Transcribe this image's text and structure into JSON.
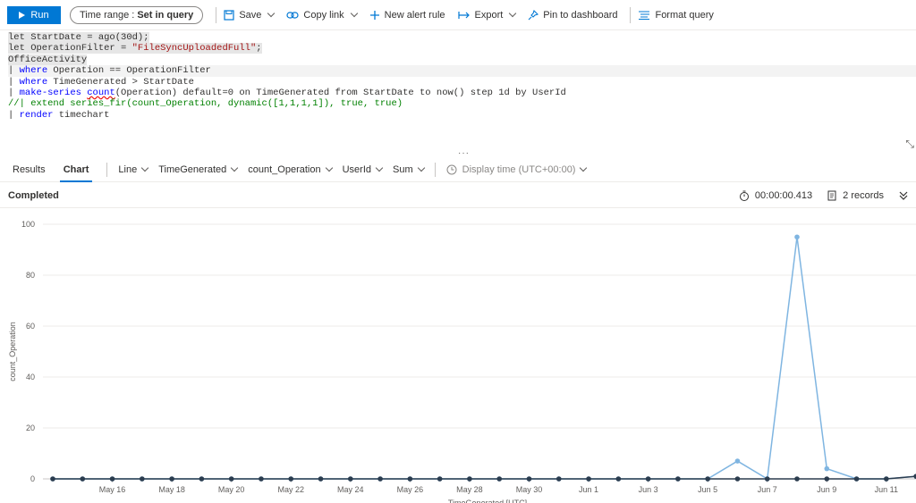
{
  "toolbar": {
    "run_label": "Run",
    "time_range_prefix": "Time range :",
    "time_range_value": "Set in query",
    "save_label": "Save",
    "copy_link_label": "Copy link",
    "new_alert_label": "New alert rule",
    "export_label": "Export",
    "pin_label": "Pin to dashboard",
    "format_label": "Format query"
  },
  "editor": {
    "lines": [
      "let StartDate = ago(30d);",
      "let OperationFilter = \"FileSyncUploadedFull\";",
      "OfficeActivity",
      "| where Operation == OperationFilter",
      "| where TimeGenerated > StartDate",
      "| make-series count(Operation) default=0 on TimeGenerated from StartDate to now() step 1d by UserId",
      "//| extend series_fir(count_Operation, dynamic([1,1,1,1]), true, true)",
      "| render timechart"
    ]
  },
  "tabs": {
    "results_label": "Results",
    "chart_label": "Chart",
    "chart_type": "Line",
    "x_column": "TimeGenerated",
    "y_column": "count_Operation",
    "split_column": "UserId",
    "aggregation": "Sum",
    "display_time": "Display time (UTC+00:00)"
  },
  "status": {
    "state": "Completed",
    "duration": "00:00:00.413",
    "records": "2 records"
  },
  "chart_data": {
    "type": "line",
    "ylabel": "count_Operation",
    "xlabel": "TimeGenerated [UTC]",
    "ylim": [
      0,
      100
    ],
    "y_ticks": [
      "0",
      "20",
      "40",
      "60",
      "80",
      "100"
    ],
    "x_ticks": [
      "May 16",
      "May 18",
      "May 20",
      "May 22",
      "May 24",
      "May 26",
      "May 28",
      "May 30",
      "Jun 1",
      "Jun 3",
      "Jun 5",
      "Jun 7",
      "Jun 9",
      "Jun 11"
    ],
    "x": [
      "May 14",
      "May 15",
      "May 16",
      "May 17",
      "May 18",
      "May 19",
      "May 20",
      "May 21",
      "May 22",
      "May 23",
      "May 24",
      "May 25",
      "May 26",
      "May 27",
      "May 28",
      "May 29",
      "May 30",
      "May 31",
      "Jun 1",
      "Jun 2",
      "Jun 3",
      "Jun 4",
      "Jun 5",
      "Jun 6",
      "Jun 7",
      "Jun 8",
      "Jun 9",
      "Jun 10",
      "Jun 11",
      "Jun 12"
    ],
    "series": [
      {
        "color": "#7fb5e1",
        "values": [
          0,
          0,
          0,
          0,
          0,
          0,
          0,
          0,
          0,
          0,
          0,
          0,
          0,
          0,
          0,
          0,
          0,
          0,
          0,
          0,
          0,
          0,
          0,
          7,
          0,
          95,
          4,
          0,
          0,
          1
        ]
      },
      {
        "color": "#2b3c4e",
        "values": [
          0,
          0,
          0,
          0,
          0,
          0,
          0,
          0,
          0,
          0,
          0,
          0,
          0,
          0,
          0,
          0,
          0,
          0,
          0,
          0,
          0,
          0,
          0,
          0,
          0,
          0,
          0,
          0,
          0,
          1
        ]
      }
    ]
  }
}
